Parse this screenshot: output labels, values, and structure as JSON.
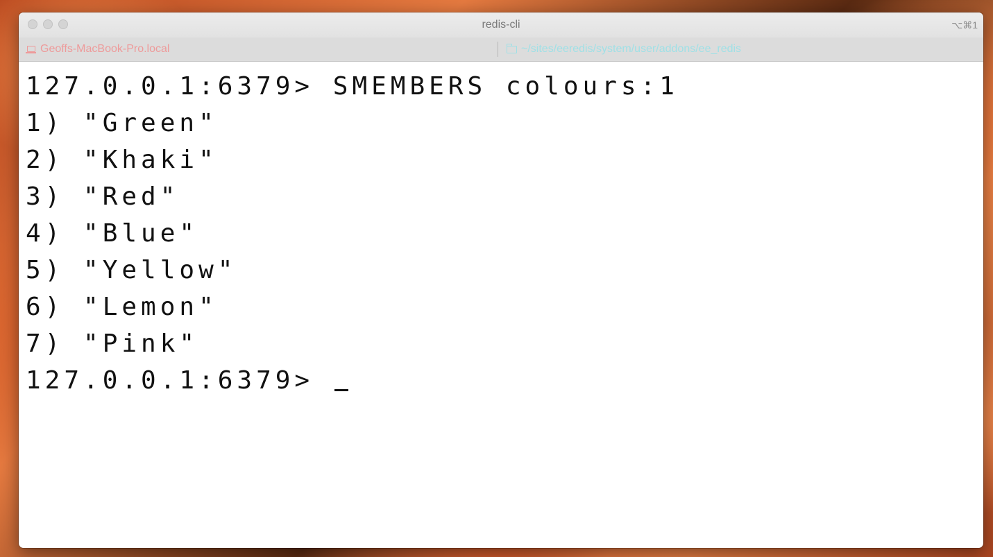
{
  "window": {
    "title": "redis-cli",
    "shortcut": "⌥⌘1"
  },
  "statusbar": {
    "host": "Geoffs-MacBook-Pro.local",
    "path": "~/sites/eeredis/system/user/addons/ee_redis"
  },
  "terminal": {
    "command_line": "127.0.0.1:6379> SMEMBERS colours:1",
    "output": [
      "1) \"Green\"",
      "2) \"Khaki\"",
      "3) \"Red\"",
      "4) \"Blue\"",
      "5) \"Yellow\"",
      "6) \"Lemon\"",
      "7) \"Pink\""
    ],
    "prompt": "127.0.0.1:6379> "
  }
}
